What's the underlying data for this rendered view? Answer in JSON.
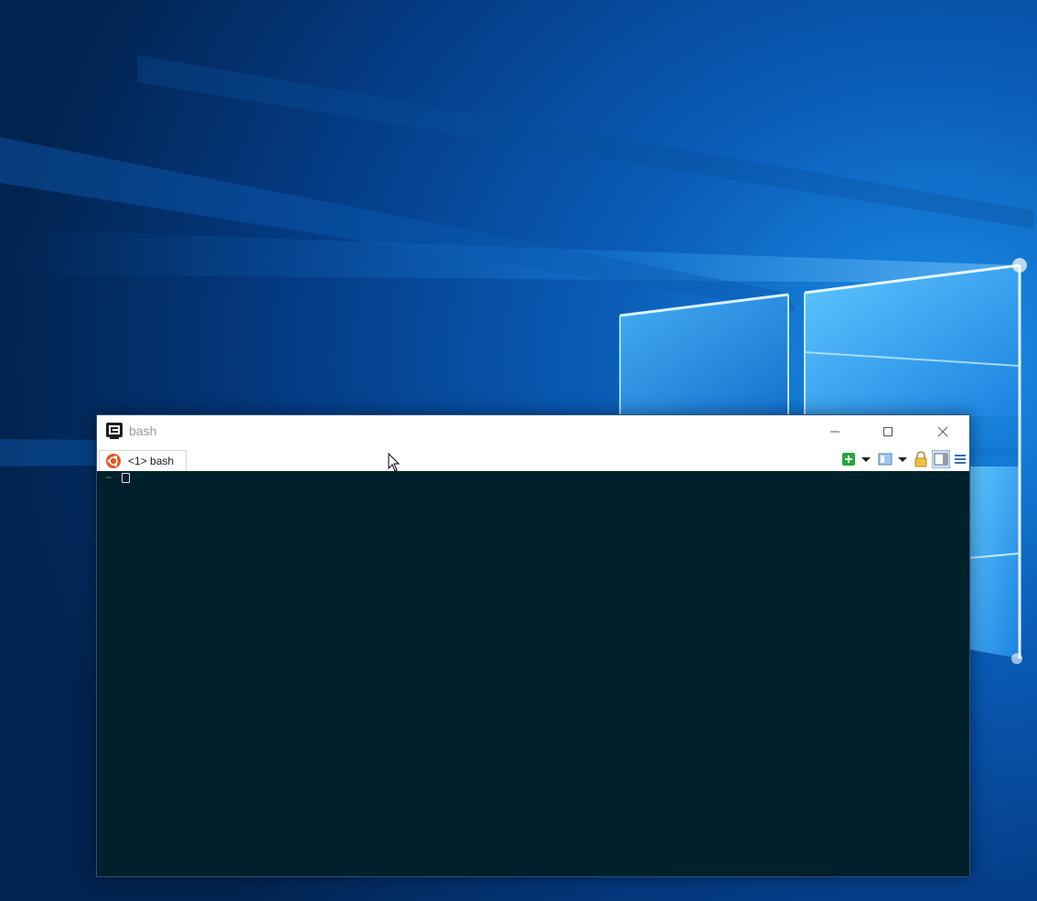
{
  "window": {
    "title": "bash",
    "app_icon": "conemu-icon",
    "controls": {
      "minimize": "minimize-icon",
      "maximize": "maximize-icon",
      "close": "close-icon"
    }
  },
  "tabs": [
    {
      "label": "<1> bash",
      "icon": "ubuntu-icon",
      "active": true
    }
  ],
  "toolbar": [
    {
      "name": "new-console-icon"
    },
    {
      "name": "new-console-dropdown-icon"
    },
    {
      "name": "split-layout-icon"
    },
    {
      "name": "split-layout-dropdown-icon"
    },
    {
      "name": "lock-icon"
    },
    {
      "name": "panel-toggle-icon"
    },
    {
      "name": "menu-icon"
    }
  ],
  "terminal": {
    "prompt": "~",
    "background": "#00212b",
    "prompt_color": "#586e75"
  },
  "colors": {
    "desktop": "#032a5c",
    "ubuntu_orange": "#e95420",
    "add_green": "#22a83a"
  }
}
